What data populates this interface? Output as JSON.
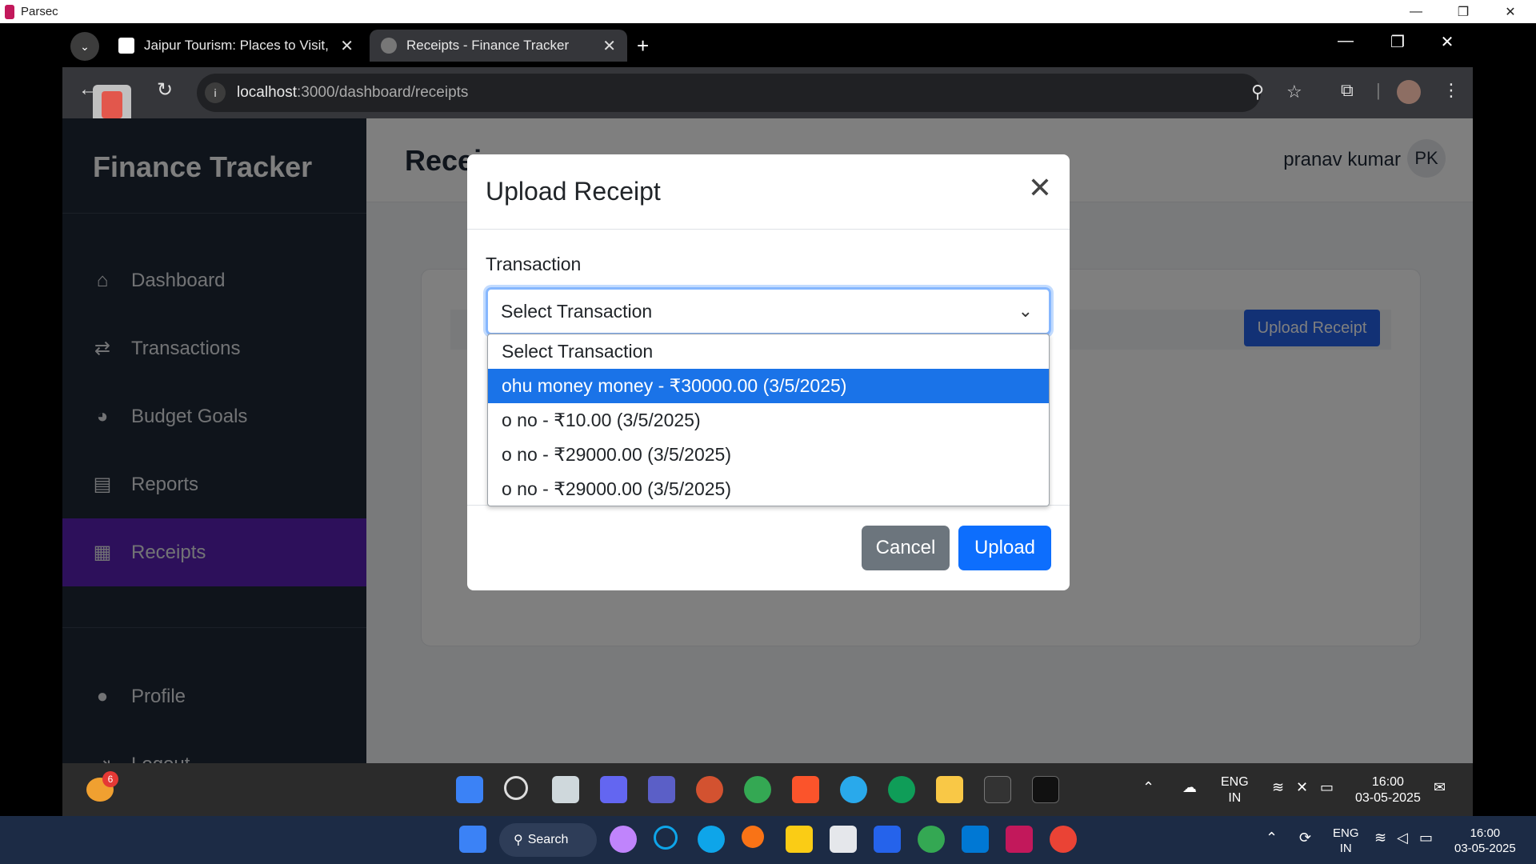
{
  "parsec": {
    "title": "Parsec",
    "minimize": "—",
    "restore": "❐",
    "close": "✕"
  },
  "browser": {
    "tabs": [
      {
        "label": "Jaipur Tourism: Places to Visit, S",
        "close": "✕"
      },
      {
        "label": "Receipts - Finance Tracker",
        "close": "✕"
      }
    ],
    "new_tab": "+",
    "url_host": "localhost",
    "url_path": ":3000/dashboard/receipts",
    "minimize": "—",
    "restore": "❐",
    "close": "✕"
  },
  "app": {
    "brand": "Finance Tracker",
    "nav": [
      {
        "label": "Dashboard",
        "icon": "home-icon"
      },
      {
        "label": "Transactions",
        "icon": "arrows-icon"
      },
      {
        "label": "Budget Goals",
        "icon": "pie-chart-icon"
      },
      {
        "label": "Reports",
        "icon": "bar-chart-icon"
      },
      {
        "label": "Receipts",
        "icon": "receipt-icon",
        "active": true
      }
    ],
    "nav_bottom": [
      {
        "label": "Profile",
        "icon": "user-icon"
      },
      {
        "label": "Logout",
        "icon": "logout-icon"
      }
    ],
    "page_title": "Recei",
    "user_name": "pranav kumar",
    "user_initials": "PK",
    "card_upload_button": "Upload Receipt",
    "accent_color": "#5b21b6"
  },
  "modal": {
    "title": "Upload Receipt",
    "close": "✕",
    "field_label": "Transaction",
    "select_value": "Select Transaction",
    "options": [
      "Select Transaction",
      "ohu money money - ₹30000.00 (3/5/2025)",
      "o no - ₹10.00 (3/5/2025)",
      "o no - ₹29000.00 (3/5/2025)",
      "o no - ₹29000.00 (3/5/2025)"
    ],
    "highlighted_option_index": 1,
    "cancel_label": "Cancel",
    "upload_label": "Upload"
  },
  "remote_taskbar": {
    "badge_count": "6",
    "lang_top": "ENG",
    "lang_bottom": "IN",
    "time": "16:00",
    "date": "03-05-2025"
  },
  "host_taskbar": {
    "search_label": "Search",
    "lang_top": "ENG",
    "lang_bottom": "IN",
    "time": "16:00",
    "date": "03-05-2025"
  }
}
